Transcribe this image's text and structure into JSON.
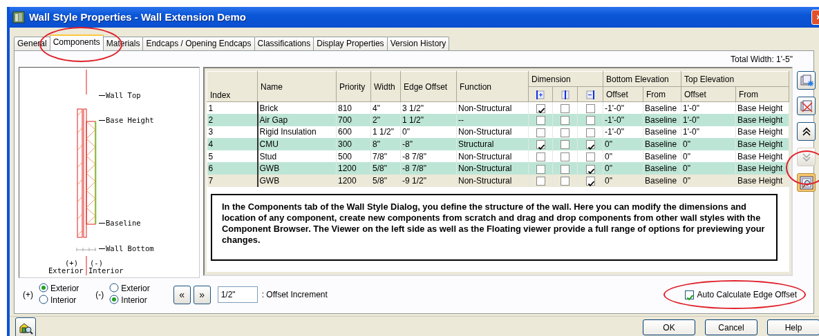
{
  "window": {
    "title": "Wall Style Properties - Wall Extension Demo"
  },
  "tabs": [
    {
      "label": "General",
      "selected": false
    },
    {
      "label": "Components",
      "selected": true
    },
    {
      "label": "Materials",
      "selected": false
    },
    {
      "label": "Endcaps / Opening Endcaps",
      "selected": false
    },
    {
      "label": "Classifications",
      "selected": false
    },
    {
      "label": "Display Properties",
      "selected": false
    },
    {
      "label": "Version History",
      "selected": false
    }
  ],
  "total_width": "Total Width: 1'-5\"",
  "preview": {
    "wall_top": "Wall Top",
    "base_height": "Base Height",
    "baseline": "Baseline",
    "wall_bottom": "Wall Bottom",
    "plus": "(+)",
    "exterior": "Exterior",
    "minus": "(-)",
    "interior": "Interior"
  },
  "table": {
    "columns": [
      "Index",
      "Name",
      "Priority",
      "Width",
      "Edge Offset",
      "Function"
    ],
    "groups": [
      {
        "label": "Dimension",
        "columns": [
          {
            "kind": "dim-plus"
          },
          {
            "kind": "dim-center"
          },
          {
            "kind": "dim-minus"
          }
        ]
      },
      {
        "label": "Bottom Elevation",
        "columns": [
          {
            "label": "Offset"
          },
          {
            "label": "From"
          }
        ]
      },
      {
        "label": "Top Elevation",
        "columns": [
          {
            "label": "Offset"
          },
          {
            "label": "From"
          }
        ]
      }
    ],
    "rows": [
      {
        "index": "1",
        "name": "Brick",
        "priority": "810",
        "width": "4\"",
        "edge_offset": "3 1/2\"",
        "function": "Non-Structural",
        "dimension": [
          {
            "checked": true
          },
          {
            "checked": false
          },
          {
            "checked": false
          }
        ],
        "bottom_offset": "-1'-0\"",
        "bottom_from": "Baseline",
        "top_offset": "1'-0\"",
        "top_from": "Base Height",
        "selected": false
      },
      {
        "index": "2",
        "name": "Air Gap",
        "priority": "700",
        "width": "2\"",
        "edge_offset": "1 1/2\"",
        "function": "--",
        "dimension": [
          {
            "checked": false
          },
          {
            "checked": false
          },
          {
            "checked": false
          }
        ],
        "bottom_offset": "-1'-0\"",
        "bottom_from": "Baseline",
        "top_offset": "1'-0\"",
        "top_from": "Base Height",
        "selected": false
      },
      {
        "index": "3",
        "name": "Rigid Insulation",
        "priority": "600",
        "width": "1 1/2\"",
        "edge_offset": "0\"",
        "function": "Non-Structural",
        "dimension": [
          {
            "checked": false
          },
          {
            "checked": false
          },
          {
            "checked": false
          }
        ],
        "bottom_offset": "-1'-0\"",
        "bottom_from": "Baseline",
        "top_offset": "1'-0\"",
        "top_from": "Base Height",
        "selected": false
      },
      {
        "index": "4",
        "name": "CMU",
        "priority": "300",
        "width": "8\"",
        "edge_offset": "-8\"",
        "function": "Structural",
        "dimension": [
          {
            "checked": true
          },
          {
            "checked": false
          },
          {
            "checked": true
          }
        ],
        "bottom_offset": "0\"",
        "bottom_from": "Baseline",
        "top_offset": "0\"",
        "top_from": "Base Height",
        "selected": false
      },
      {
        "index": "5",
        "name": "Stud",
        "priority": "500",
        "width": "7/8\"",
        "edge_offset": "-8 7/8\"",
        "function": "Non-Structural",
        "dimension": [
          {
            "checked": false
          },
          {
            "checked": false
          },
          {
            "checked": false
          }
        ],
        "bottom_offset": "0\"",
        "bottom_from": "Baseline",
        "top_offset": "0\"",
        "top_from": "Base Height",
        "selected": false
      },
      {
        "index": "6",
        "name": "GWB",
        "priority": "1200",
        "width": "5/8\"",
        "edge_offset": "-8 7/8\"",
        "function": "Non-Structural",
        "dimension": [
          {
            "checked": false
          },
          {
            "checked": false
          },
          {
            "checked": true
          }
        ],
        "bottom_offset": "0\"",
        "bottom_from": "Baseline",
        "top_offset": "0\"",
        "top_from": "Base Height",
        "selected": false
      },
      {
        "index": "7",
        "name": "GWB",
        "priority": "1200",
        "width": "5/8\"",
        "edge_offset": "-9 1/2\"",
        "function": "Non-Structural",
        "dimension": [
          {
            "checked": false
          },
          {
            "checked": false
          },
          {
            "checked": true
          }
        ],
        "bottom_offset": "0\"",
        "bottom_from": "Baseline",
        "top_offset": "0\"",
        "top_from": "Base Height",
        "selected": true
      }
    ]
  },
  "note": "In the Components tab of the Wall Style Dialog, you define the structure of the wall. Here you can modify the dimensions and location of any component, create new components from scratch and drag and drop components from other  wall styles with the Component Browser. The Viewer  on the left side as well as the Floating viewer provide a full range of options for previewing your changes.",
  "side_buttons": [
    {
      "kind": "add",
      "disabled": false
    },
    {
      "kind": "delete",
      "disabled": false
    },
    {
      "kind": "up",
      "disabled": false
    },
    {
      "kind": "down",
      "disabled": true
    },
    {
      "kind": "browse",
      "disabled": false
    }
  ],
  "plus_side": {
    "label": "(+)",
    "options": [
      {
        "label": "Exterior",
        "selected": true
      },
      {
        "label": "Interior",
        "selected": false
      }
    ]
  },
  "minus_side": {
    "label": "(-)",
    "options": [
      {
        "label": "Exterior",
        "selected": false
      },
      {
        "label": "Interior",
        "selected": true
      }
    ]
  },
  "nav_buttons": [
    "«",
    "»"
  ],
  "offset_increment": {
    "value": "1/2\"",
    "label": ": Offset Increment"
  },
  "auto_calculate": {
    "label": "Auto Calculate Edge Offset",
    "checked": true
  },
  "footer_buttons": [
    "OK",
    "Cancel",
    "Help"
  ]
}
